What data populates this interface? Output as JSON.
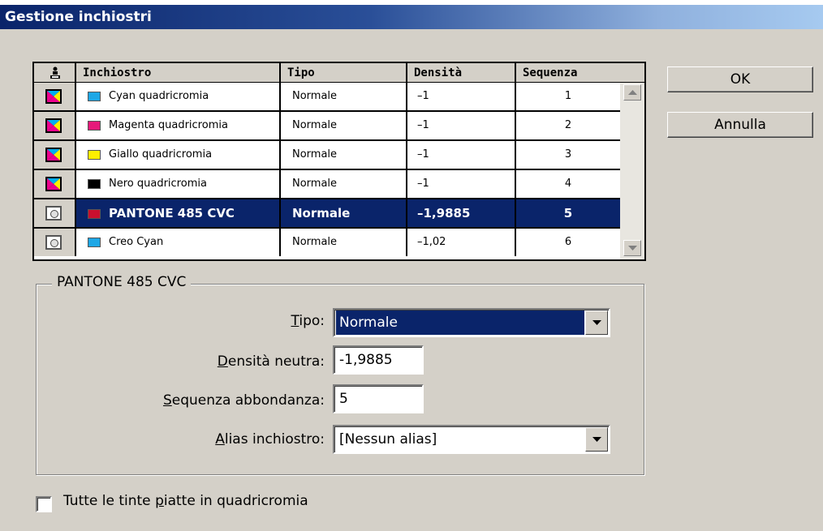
{
  "window": {
    "title": "Gestione inchiostri"
  },
  "table": {
    "headers": {
      "icon": "ink-type-icon",
      "name": "Inchiostro",
      "type": "Tipo",
      "density": "Densità",
      "sequence": "Sequenza"
    },
    "rows": [
      {
        "kind": "process",
        "swatch": "#1ea7e6",
        "name": "Cyan quadricromia",
        "type": "Normale",
        "density": "–1",
        "sequence": "1"
      },
      {
        "kind": "process",
        "swatch": "#e6197a",
        "name": "Magenta quadricromia",
        "type": "Normale",
        "density": "–1",
        "sequence": "2"
      },
      {
        "kind": "process",
        "swatch": "#ffee00",
        "name": "Giallo quadricromia",
        "type": "Normale",
        "density": "–1",
        "sequence": "3"
      },
      {
        "kind": "process",
        "swatch": "#000000",
        "name": "Nero quadricromia",
        "type": "Normale",
        "density": "–1",
        "sequence": "4"
      },
      {
        "kind": "spot",
        "swatch": "#c8102e",
        "name": "PANTONE 485 CVC",
        "type": "Normale",
        "density": "–1,9885",
        "sequence": "5",
        "selected": true
      },
      {
        "kind": "spot",
        "swatch": "#1ea7e6",
        "name": "Creo Cyan",
        "type": "Normale",
        "density": "–1,02",
        "sequence": "6"
      }
    ]
  },
  "buttons": {
    "ok": "OK",
    "cancel": "Annulla"
  },
  "details": {
    "legend": "PANTONE 485 CVC",
    "type_label_accel": "T",
    "type_label_rest": "ipo:",
    "type_value": "Normale",
    "density_label_accel": "D",
    "density_label_rest": "ensità neutra:",
    "density_value": "-1,9885",
    "sequence_label_accel": "S",
    "sequence_label_rest": "equenza abbondanza:",
    "sequence_value": "5",
    "alias_label_accel": "A",
    "alias_label_rest": "lias inchiostro:",
    "alias_value": "[Nessun alias]"
  },
  "checkbox": {
    "label_pre": "Tutte le tinte ",
    "label_accel": "p",
    "label_post": "iatte in quadricromia",
    "checked": false
  },
  "colors": {
    "selection": "#0a246a",
    "dialog_bg": "#d4d0c8"
  }
}
